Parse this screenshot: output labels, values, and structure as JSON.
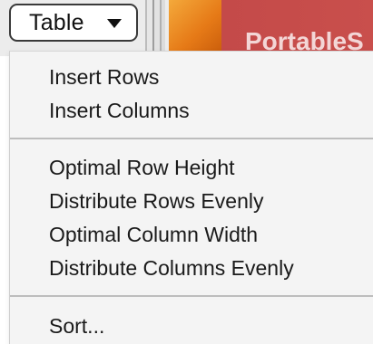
{
  "toolbar": {
    "table_button_label": "Table",
    "banner_text": "PortableS"
  },
  "menu": {
    "items": [
      {
        "label": "Insert Rows"
      },
      {
        "label": "Insert Columns"
      },
      {
        "label": "Optimal Row Height"
      },
      {
        "label": "Distribute Rows Evenly"
      },
      {
        "label": "Optimal Column Width"
      },
      {
        "label": "Distribute Columns Evenly"
      },
      {
        "label": "Sort..."
      }
    ]
  },
  "icons": {
    "dropdown": "chevron-down-icon"
  },
  "colors": {
    "banner": "#c44a49",
    "swatch": "#e67a17",
    "menu_background": "#f4f4f4"
  }
}
